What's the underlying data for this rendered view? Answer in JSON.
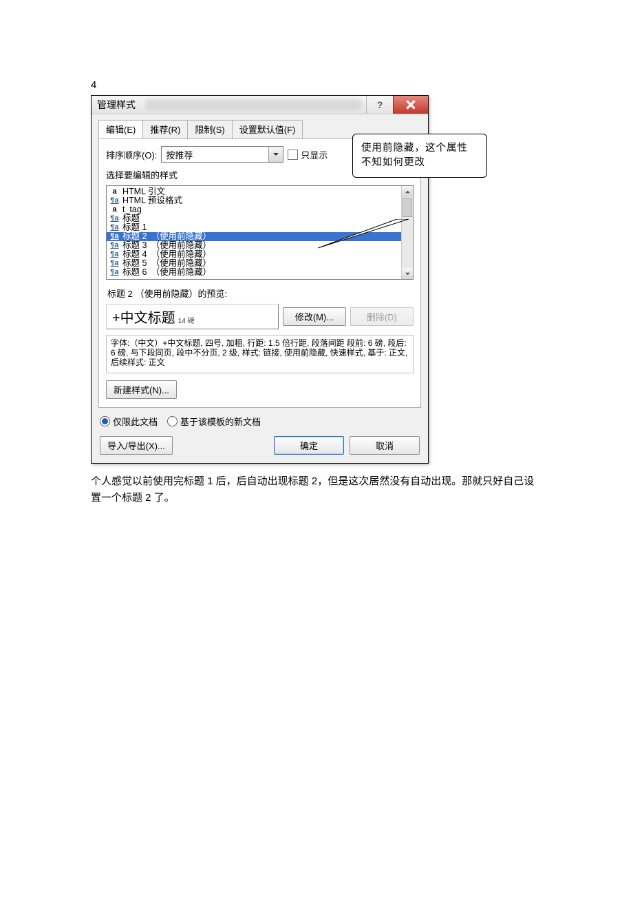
{
  "page_number": "4",
  "dialog": {
    "title": "管理样式",
    "help_tooltip": "?",
    "tabs": [
      "编辑(E)",
      "推荐(R)",
      "限制(S)",
      "设置默认值(F)"
    ],
    "active_tab_index": 0,
    "sort_label": "排序顺序(O):",
    "sort_value": "按推荐",
    "only_show_checkbox": "只显示",
    "select_style_label": "选择要编辑的样式",
    "styles": [
      {
        "icon": "a",
        "icon_class": "plain",
        "label": "HTML 引文"
      },
      {
        "icon": "¶a",
        "icon_class": "",
        "label": "HTML 预设格式"
      },
      {
        "icon": "a",
        "icon_class": "plain",
        "label": "t_tag"
      },
      {
        "icon": "¶a",
        "icon_class": "",
        "label": "标题"
      },
      {
        "icon": "¶a",
        "icon_class": "",
        "label": "标题 1"
      },
      {
        "icon": "¶a",
        "icon_class": "",
        "label": "标题 2　（使用前隐藏）",
        "selected": true
      },
      {
        "icon": "¶a",
        "icon_class": "",
        "label": "标题 3　（使用前隐藏）"
      },
      {
        "icon": "¶a",
        "icon_class": "",
        "label": "标题 4　（使用前隐藏）"
      },
      {
        "icon": "¶a",
        "icon_class": "",
        "label": "标题 5　（使用前隐藏）"
      },
      {
        "icon": "¶a",
        "icon_class": "",
        "label": "标题 6　（使用前隐藏）"
      }
    ],
    "preview_label": "标题 2 （使用前隐藏）的预览:",
    "preview_main": "+中文标题",
    "preview_sub": "14 磅",
    "modify_btn": "修改(M)...",
    "delete_btn": "删除(D)",
    "description": "字体:（中文）+中文标题, 四号, 加粗, 行距: 1.5 倍行距, 段落间距 段前: 6 磅, 段后: 6 磅, 与下段同页, 段中不分页, 2 级, 样式: 链接, 使用前隐藏, 快速样式, 基于: 正文, 后续样式: 正文",
    "new_style_btn": "新建样式(N)...",
    "radio_doc_only": "仅限此文档",
    "radio_template": "基于该模板的新文档",
    "import_export_btn": "导入/导出(X)...",
    "ok_btn": "确定",
    "cancel_btn": "取消"
  },
  "callout_text": "使用前隐藏，这个属性不知如何更改",
  "body_text": "个人感觉以前使用完标题 1 后，后自动出现标题 2，但是这次居然没有自动出现。那就只好自己设置一个标题 2 了。"
}
